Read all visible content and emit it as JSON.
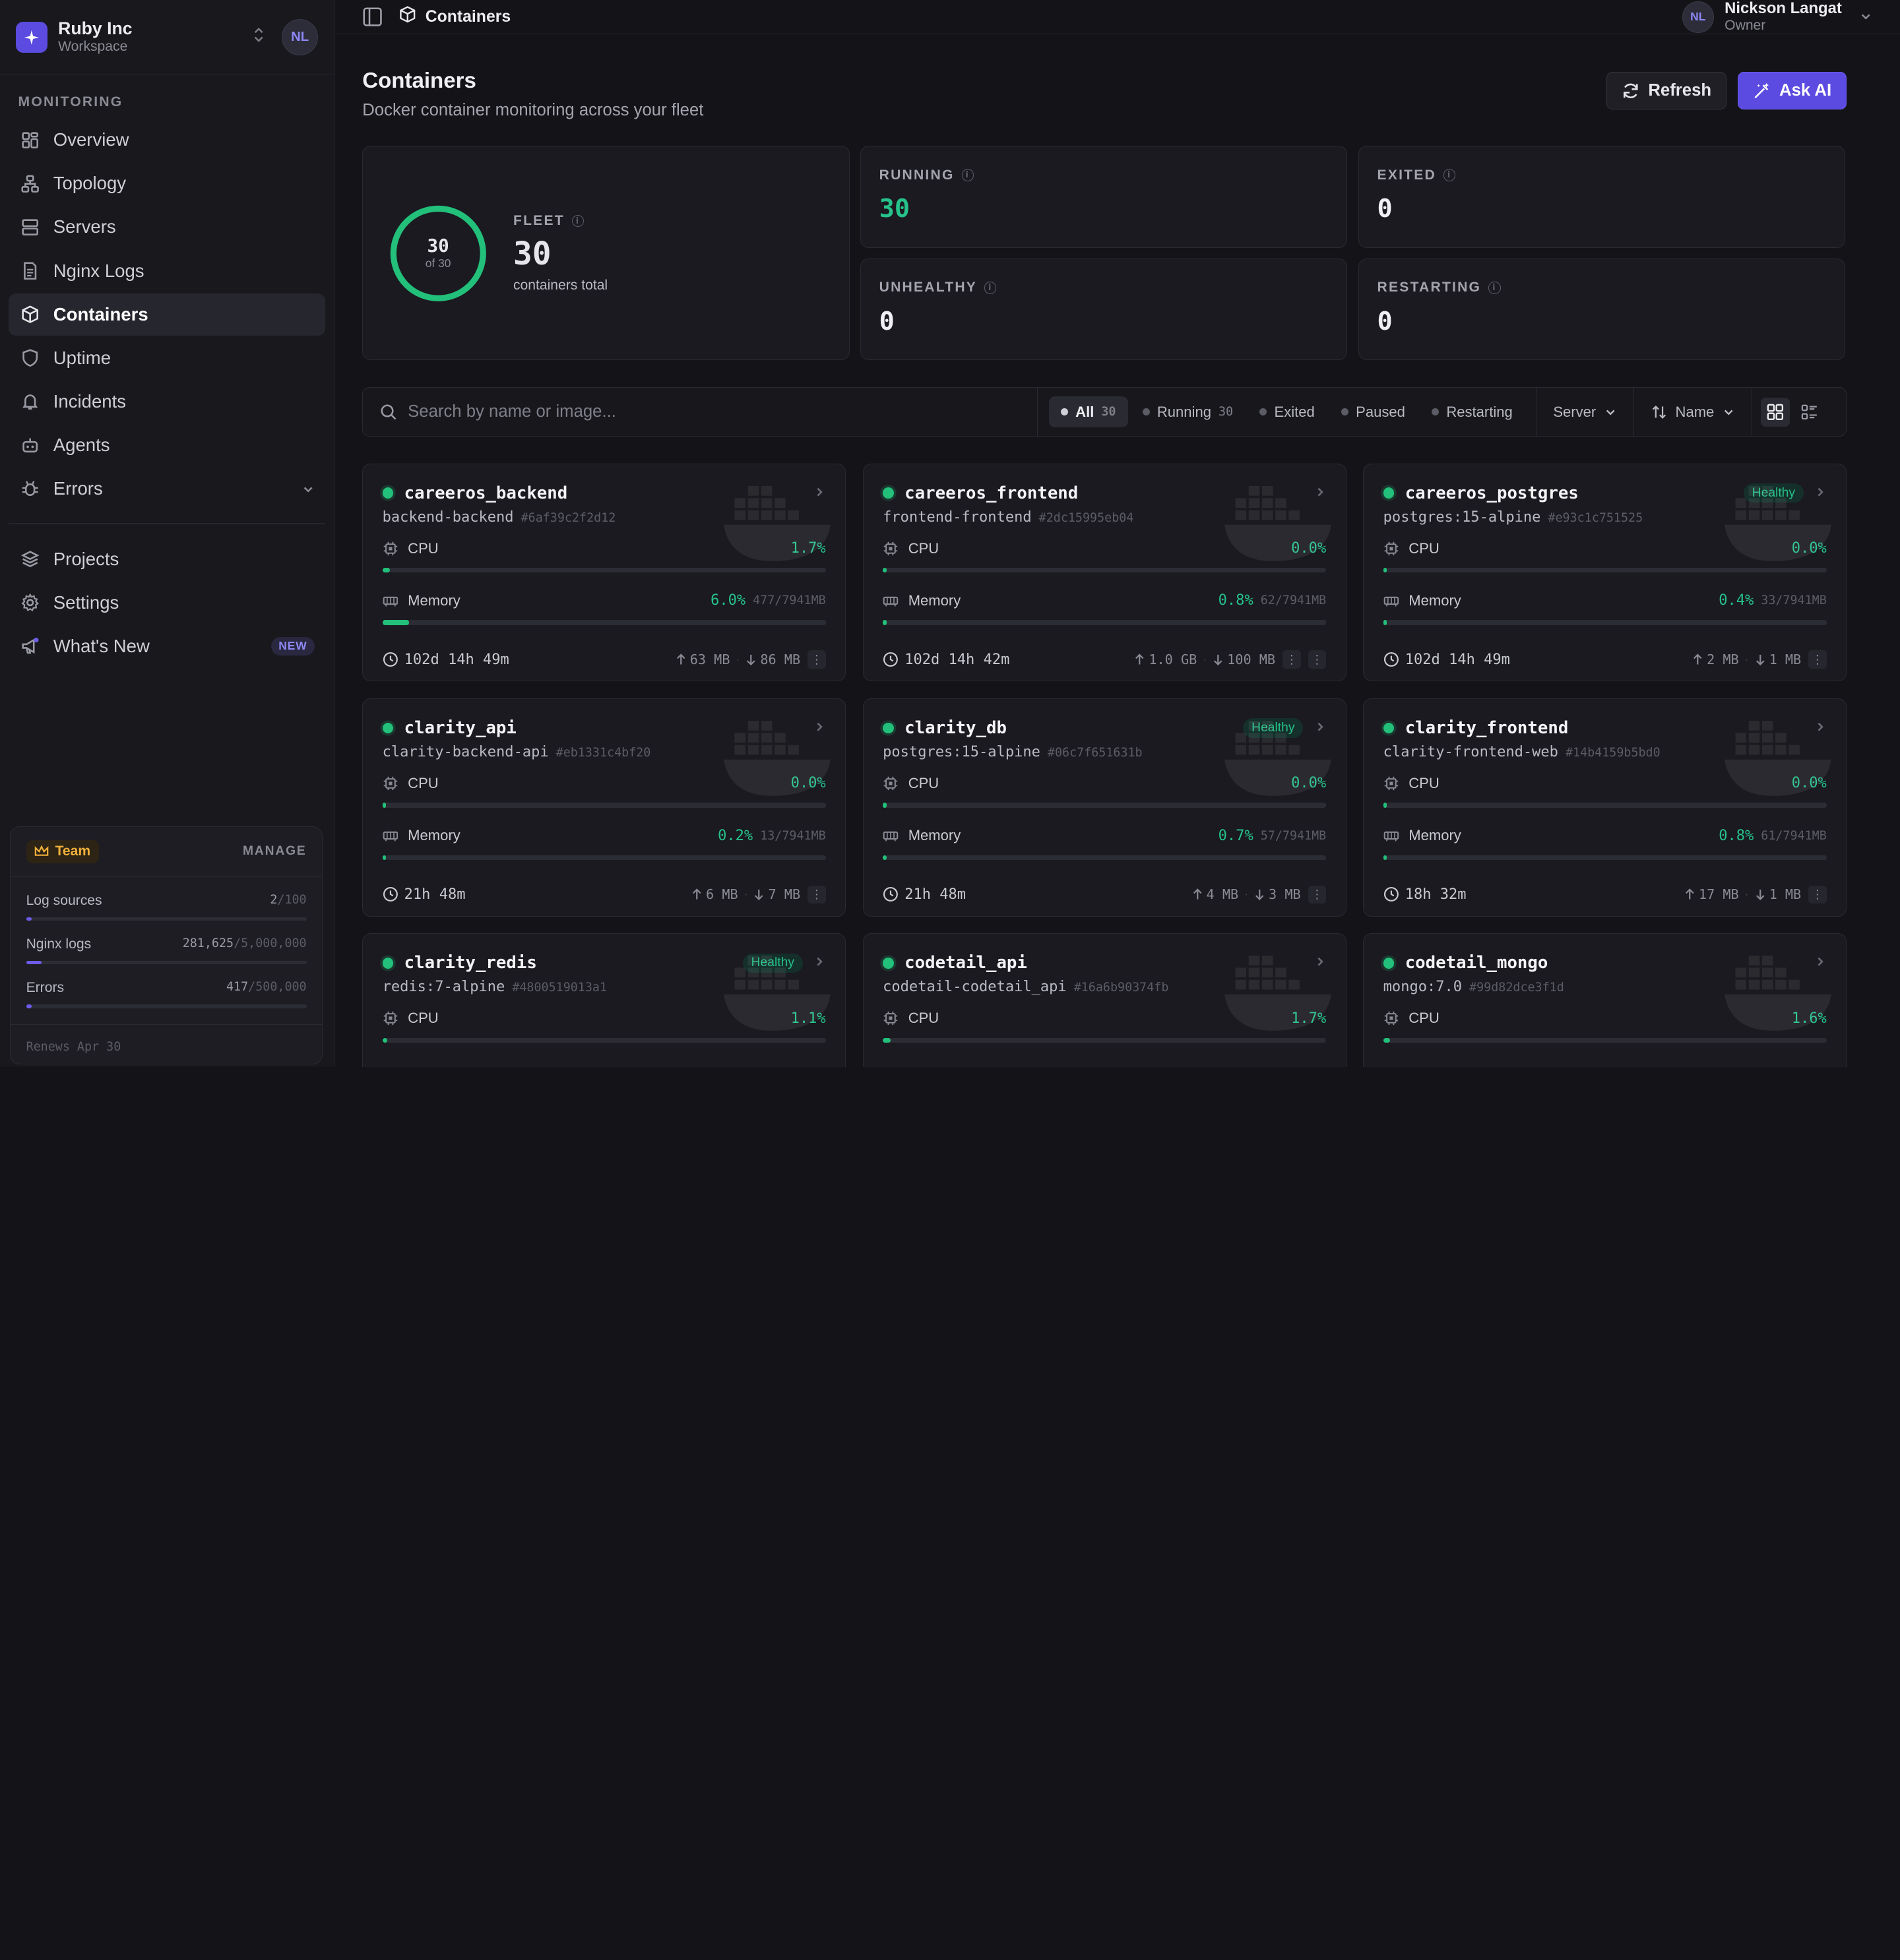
{
  "workspace": {
    "name": "Ruby Inc",
    "subtitle": "Workspace",
    "user_initials": "NL"
  },
  "nav": {
    "section": "MONITORING",
    "items": [
      {
        "label": "Overview",
        "icon": "grid-icon"
      },
      {
        "label": "Topology",
        "icon": "topology-icon"
      },
      {
        "label": "Servers",
        "icon": "server-icon"
      },
      {
        "label": "Nginx Logs",
        "icon": "file-icon"
      },
      {
        "label": "Containers",
        "icon": "box-icon"
      },
      {
        "label": "Uptime",
        "icon": "shield-icon"
      },
      {
        "label": "Incidents",
        "icon": "bell-icon"
      },
      {
        "label": "Agents",
        "icon": "bot-icon"
      },
      {
        "label": "Errors",
        "icon": "bug-icon"
      }
    ],
    "secondary": [
      {
        "label": "Projects",
        "icon": "layers-icon"
      },
      {
        "label": "Settings",
        "icon": "gear-icon"
      },
      {
        "label": "What's New",
        "icon": "megaphone-icon",
        "badge": "NEW"
      }
    ]
  },
  "plan": {
    "name": "Team",
    "manage": "MANAGE",
    "quotas": [
      {
        "label": "Log sources",
        "used": "2",
        "limit": "/100",
        "fraction": 0.02
      },
      {
        "label": "Nginx logs",
        "used": "281,625",
        "limit": "/5,000,000",
        "fraction": 0.056
      },
      {
        "label": "Errors",
        "used": "417",
        "limit": "/500,000",
        "fraction": 0.001
      }
    ],
    "renews": "Renews Apr 30"
  },
  "topbar": {
    "crumb": "Containers",
    "user_name": "Nickson Langat",
    "user_role": "Owner",
    "user_initials": "NL"
  },
  "page": {
    "title": "Containers",
    "subtitle": "Docker container monitoring across your fleet",
    "refresh": "Refresh",
    "ask_ai": "Ask AI"
  },
  "stats": {
    "fleet": {
      "label": "FLEET",
      "value": "30",
      "caption": "containers total",
      "ring_num": "30",
      "ring_of": "of 30",
      "fraction": 1.0
    },
    "running": {
      "label": "RUNNING",
      "value": "30"
    },
    "exited": {
      "label": "EXITED",
      "value": "0"
    },
    "unhealthy": {
      "label": "UNHEALTHY",
      "value": "0"
    },
    "restarting": {
      "label": "RESTARTING",
      "value": "0"
    }
  },
  "toolbar": {
    "search_placeholder": "Search by name or image...",
    "filters": [
      {
        "label": "All",
        "count": "30"
      },
      {
        "label": "Running",
        "count": "30"
      },
      {
        "label": "Exited",
        "count": ""
      },
      {
        "label": "Paused",
        "count": ""
      },
      {
        "label": "Restarting",
        "count": ""
      }
    ],
    "server": "Server",
    "sort": "Name"
  },
  "labels": {
    "cpu": "CPU",
    "memory": "Memory"
  },
  "containers": [
    {
      "name": "careeros_backend",
      "image": "backend-backend",
      "id": "#6af39c2f2d12",
      "healthy": "",
      "cpu": "1.7%",
      "cpu_frac": 0.017,
      "mem": "6.0%",
      "mem_frac": 0.06,
      "mem_mb": "477/7941MB",
      "uptime": "102d 14h 49m",
      "up": "63 MB",
      "down": "86 MB",
      "kebabs": 1
    },
    {
      "name": "careeros_frontend",
      "image": "frontend-frontend",
      "id": "#2dc15995eb04",
      "healthy": "",
      "cpu": "0.0%",
      "cpu_frac": 0,
      "mem": "0.8%",
      "mem_frac": 0.008,
      "mem_mb": "62/7941MB",
      "uptime": "102d 14h 42m",
      "up": "1.0 GB",
      "down": "100 MB",
      "kebabs": 2
    },
    {
      "name": "careeros_postgres",
      "image": "postgres:15-alpine",
      "id": "#e93c1c751525",
      "healthy": "Healthy",
      "cpu": "0.0%",
      "cpu_frac": 0,
      "mem": "0.4%",
      "mem_frac": 0.004,
      "mem_mb": "33/7941MB",
      "uptime": "102d 14h 49m",
      "up": "2 MB",
      "down": "1 MB",
      "kebabs": 1
    },
    {
      "name": "clarity_api",
      "image": "clarity-backend-api",
      "id": "#eb1331c4bf20",
      "healthy": "",
      "cpu": "0.0%",
      "cpu_frac": 0,
      "mem": "0.2%",
      "mem_frac": 0.002,
      "mem_mb": "13/7941MB",
      "uptime": "21h 48m",
      "up": "6 MB",
      "down": "7 MB",
      "kebabs": 1
    },
    {
      "name": "clarity_db",
      "image": "postgres:15-alpine",
      "id": "#06c7f651631b",
      "healthy": "Healthy",
      "cpu": "0.0%",
      "cpu_frac": 0,
      "mem": "0.7%",
      "mem_frac": 0.007,
      "mem_mb": "57/7941MB",
      "uptime": "21h 48m",
      "up": "4 MB",
      "down": "3 MB",
      "kebabs": 1
    },
    {
      "name": "clarity_frontend",
      "image": "clarity-frontend-web",
      "id": "#14b4159b5bd0",
      "healthy": "",
      "cpu": "0.0%",
      "cpu_frac": 0,
      "mem": "0.8%",
      "mem_frac": 0.008,
      "mem_mb": "61/7941MB",
      "uptime": "18h 32m",
      "up": "17 MB",
      "down": "1 MB",
      "kebabs": 1
    },
    {
      "name": "clarity_redis",
      "image": "redis:7-alpine",
      "id": "#4800519013a1",
      "healthy": "Healthy",
      "cpu": "1.1%",
      "cpu_frac": 0.011,
      "mem": "",
      "mem_frac": 0,
      "mem_mb": "",
      "uptime": "",
      "up": "",
      "down": "",
      "kebabs": 1
    },
    {
      "name": "codetail_api",
      "image": "codetail-codetail_api",
      "id": "#16a6b90374fb",
      "healthy": "",
      "cpu": "1.7%",
      "cpu_frac": 0.017,
      "mem": "",
      "mem_frac": 0,
      "mem_mb": "",
      "uptime": "",
      "up": "",
      "down": "",
      "kebabs": 1
    },
    {
      "name": "codetail_mongo",
      "image": "mongo:7.0",
      "id": "#99d82dce3f1d",
      "healthy": "",
      "cpu": "1.6%",
      "cpu_frac": 0.016,
      "mem": "",
      "mem_frac": 0,
      "mem_mb": "",
      "uptime": "",
      "up": "",
      "down": "",
      "kebabs": 1
    }
  ]
}
